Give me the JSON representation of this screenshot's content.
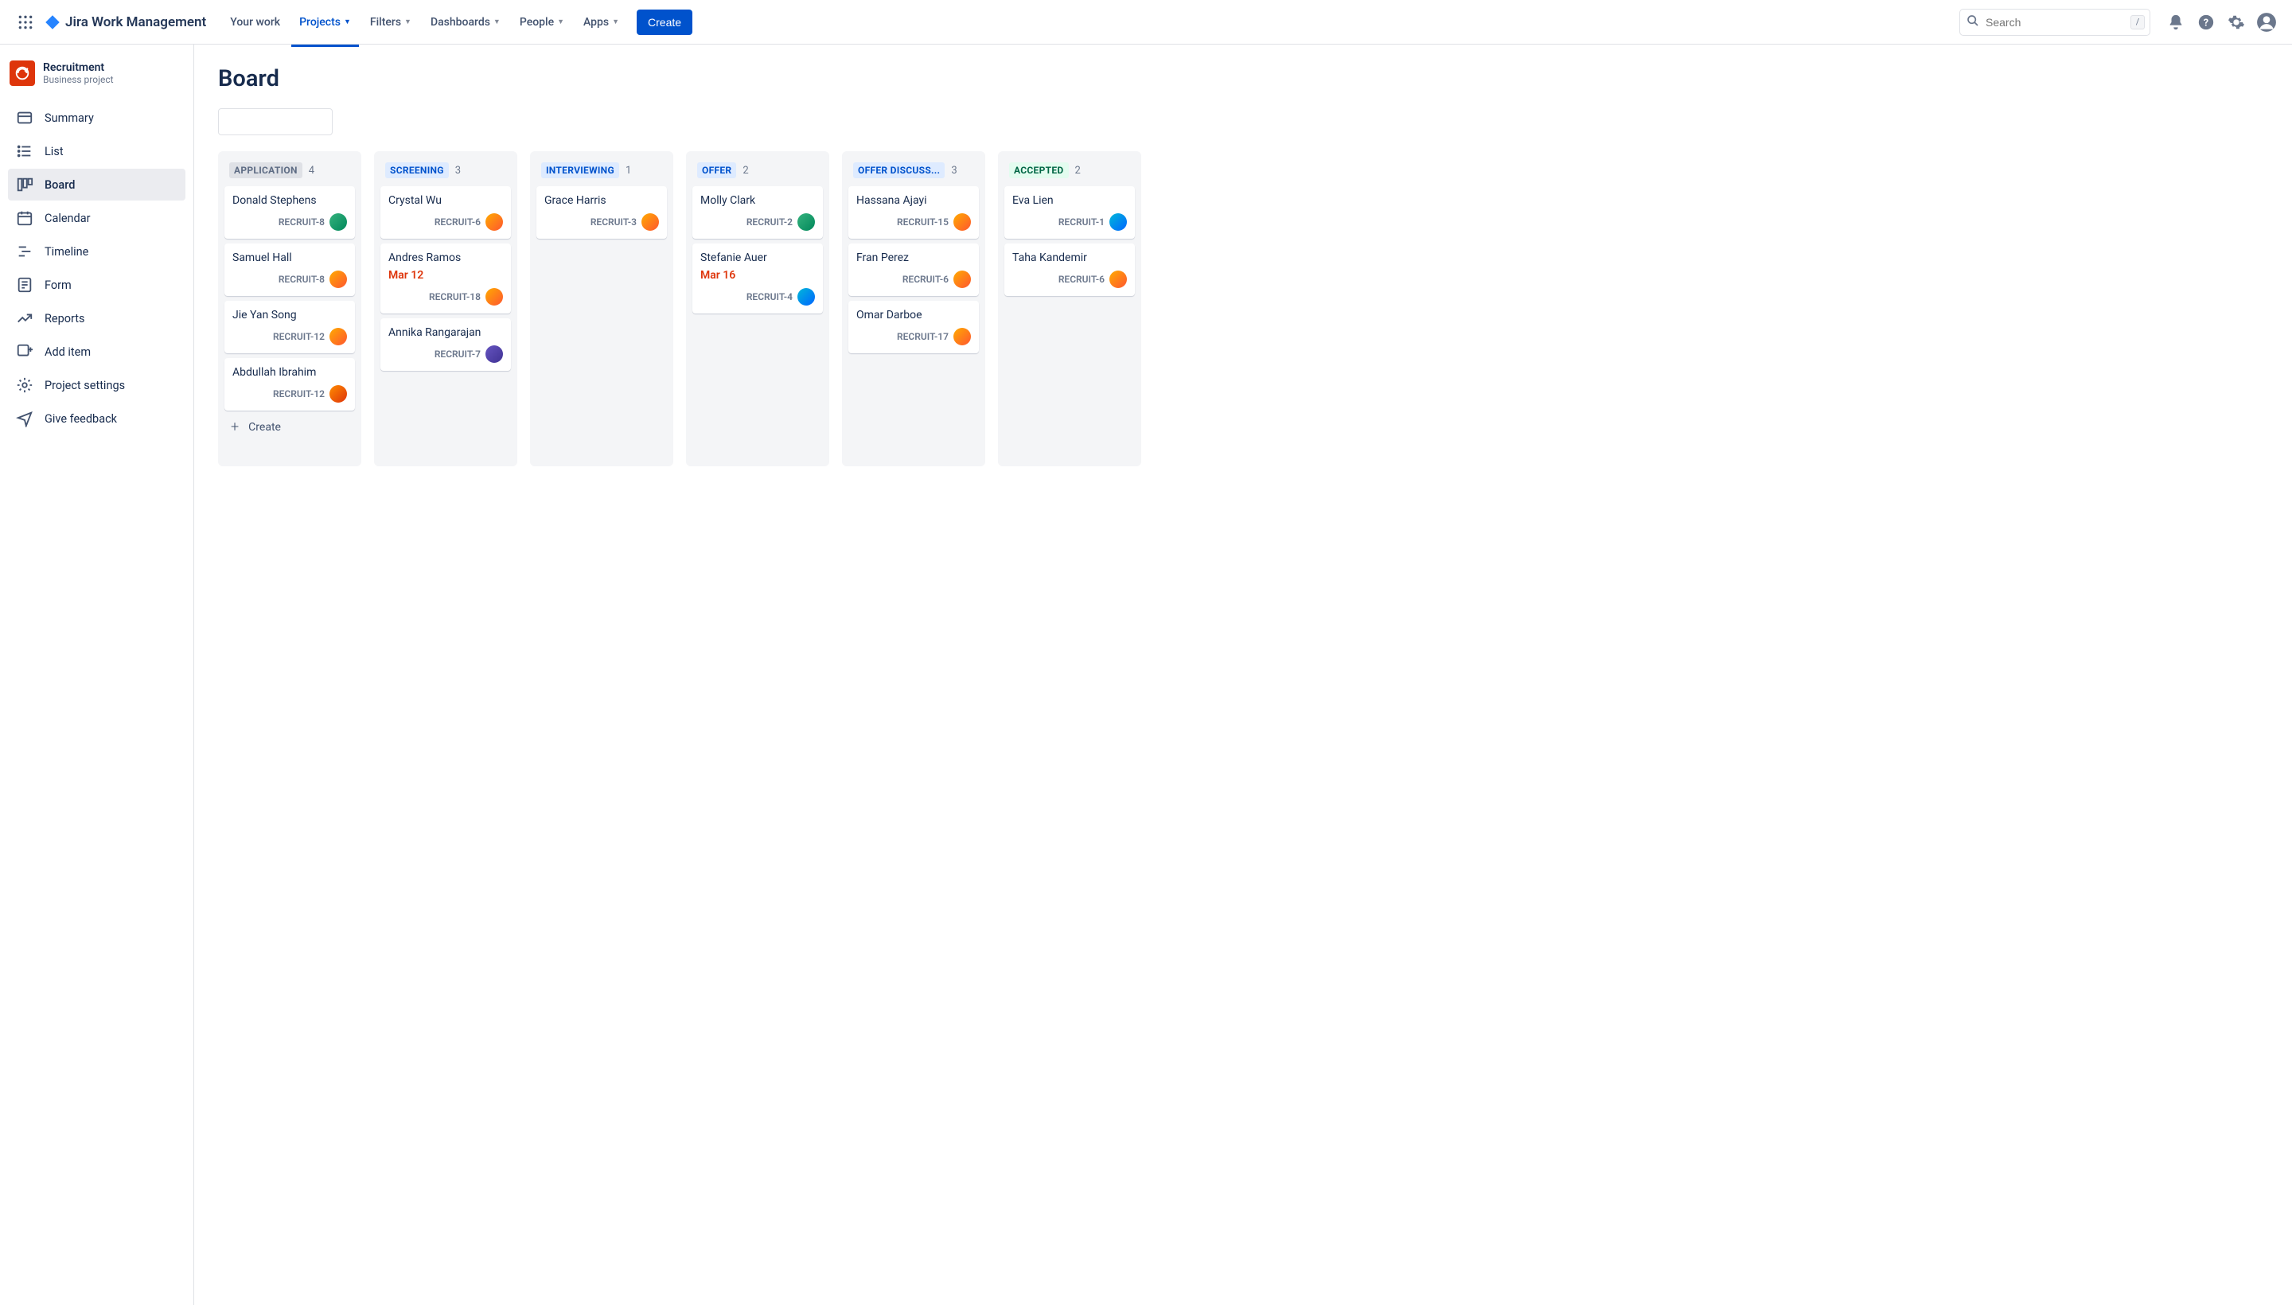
{
  "header": {
    "product_name": "Jira Work Management",
    "nav": {
      "your_work": "Your work",
      "projects": "Projects",
      "filters": "Filters",
      "dashboards": "Dashboards",
      "people": "People",
      "apps": "Apps"
    },
    "create_label": "Create",
    "search_placeholder": "Search",
    "slash": "/"
  },
  "sidebar": {
    "project_name": "Recruitment",
    "project_type": "Business project",
    "items": [
      {
        "label": "Summary"
      },
      {
        "label": "List"
      },
      {
        "label": "Board"
      },
      {
        "label": "Calendar"
      },
      {
        "label": "Timeline"
      },
      {
        "label": "Form"
      },
      {
        "label": "Reports"
      },
      {
        "label": "Add item"
      },
      {
        "label": "Project settings"
      },
      {
        "label": "Give feedback"
      }
    ]
  },
  "page": {
    "title": "Board",
    "create_label": "Create"
  },
  "columns": [
    {
      "title": "APPLICATION",
      "count": "4",
      "style": "grey",
      "cards": [
        {
          "name": "Donald Stephens",
          "key": "RECRUIT-8",
          "avatar": "a2"
        },
        {
          "name": "Samuel Hall",
          "key": "RECRUIT-8",
          "avatar": ""
        },
        {
          "name": "Jie Yan Song",
          "key": "RECRUIT-12",
          "avatar": ""
        },
        {
          "name": "Abdullah Ibrahim",
          "key": "RECRUIT-12",
          "avatar": "a4"
        }
      ],
      "show_create": true
    },
    {
      "title": "SCREENING",
      "count": "3",
      "style": "blue",
      "cards": [
        {
          "name": "Crystal Wu",
          "key": "RECRUIT-6",
          "avatar": ""
        },
        {
          "name": "Andres Ramos",
          "date": "Mar 12",
          "key": "RECRUIT-18",
          "avatar": ""
        },
        {
          "name": "Annika Rangarajan",
          "key": "RECRUIT-7",
          "avatar": "a3"
        }
      ]
    },
    {
      "title": "INTERVIEWING",
      "count": "1",
      "style": "blue",
      "cards": [
        {
          "name": "Grace Harris",
          "key": "RECRUIT-3",
          "avatar": ""
        }
      ]
    },
    {
      "title": "OFFER",
      "count": "2",
      "style": "blue",
      "cards": [
        {
          "name": "Molly Clark",
          "key": "RECRUIT-2",
          "avatar": "a2"
        },
        {
          "name": "Stefanie Auer",
          "date": "Mar 16",
          "key": "RECRUIT-4",
          "avatar": "a5"
        }
      ]
    },
    {
      "title": "OFFER DISCUSS...",
      "count": "3",
      "style": "blue",
      "cards": [
        {
          "name": "Hassana Ajayi",
          "key": "RECRUIT-15",
          "avatar": ""
        },
        {
          "name": "Fran Perez",
          "key": "RECRUIT-6",
          "avatar": ""
        },
        {
          "name": "Omar Darboe",
          "key": "RECRUIT-17",
          "avatar": ""
        }
      ]
    },
    {
      "title": "ACCEPTED",
      "count": "2",
      "style": "green",
      "cards": [
        {
          "name": "Eva Lien",
          "key": "RECRUIT-1",
          "avatar": "a5"
        },
        {
          "name": "Taha Kandemir",
          "key": "RECRUIT-6",
          "avatar": ""
        }
      ]
    }
  ]
}
